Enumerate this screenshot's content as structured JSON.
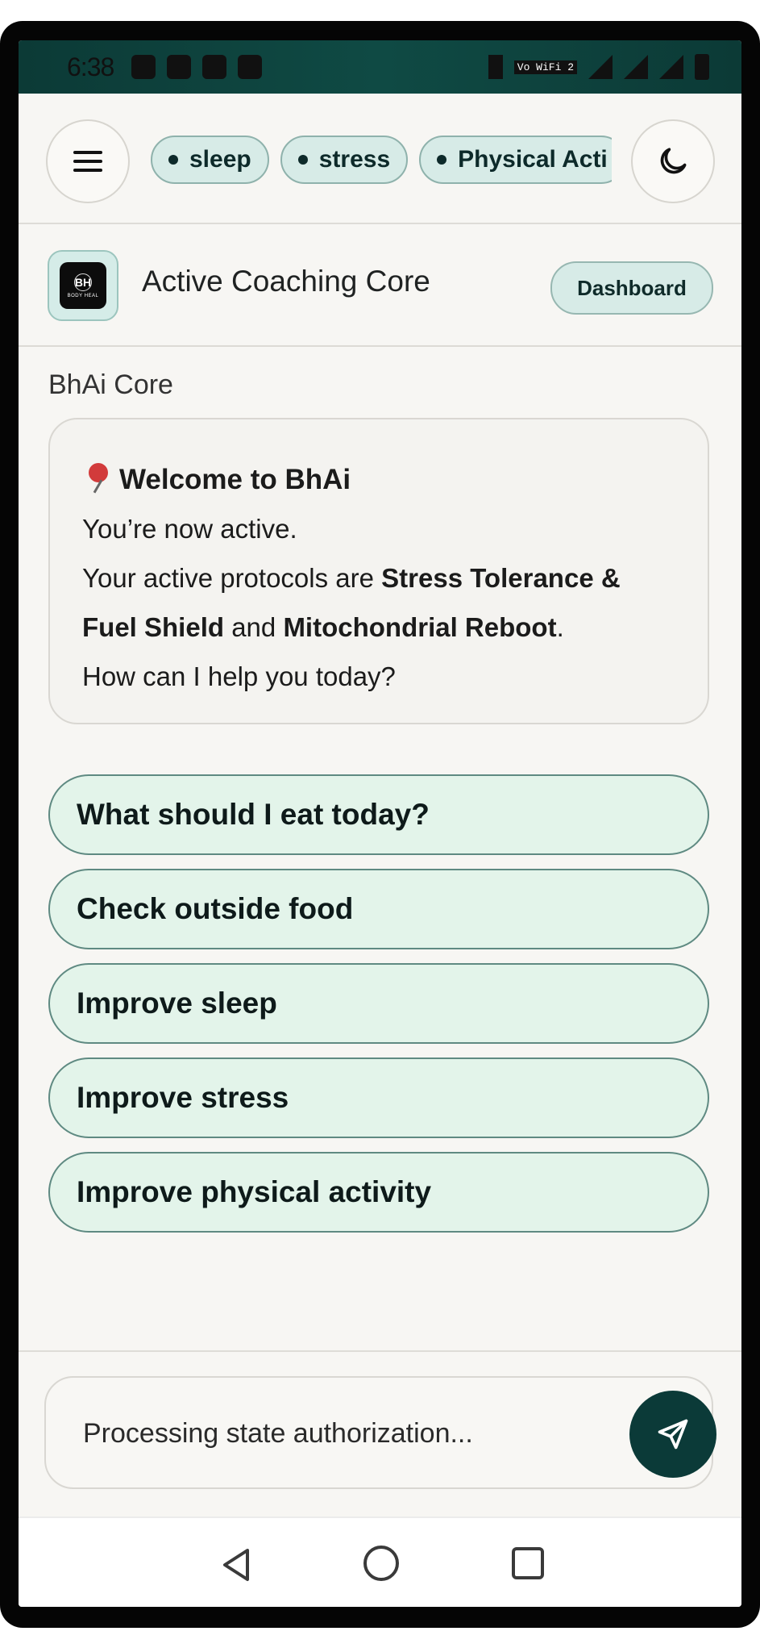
{
  "status_bar": {
    "time": "6:38",
    "network_label": "Vo WiFi 2"
  },
  "topbar": {
    "tags": [
      "sleep",
      "stress",
      "Physical Acti"
    ]
  },
  "header": {
    "logo_text": "BH",
    "logo_subtext": "BODY HEAL",
    "title": "Active Coaching Core",
    "dashboard_label": "Dashboard"
  },
  "chat": {
    "sender": "BhAi Core",
    "welcome_title": "Welcome to BhAi",
    "line1": "You’re now active.",
    "line2_prefix": "Your active protocols are ",
    "protocol1": "Stress Tolerance & Fuel Shield",
    "line2_and": " and ",
    "protocol2": "Mitochondrial Reboot",
    "line2_suffix": ".",
    "line3": "How can I help you today?"
  },
  "suggestions": [
    "What should I eat today?",
    "Check outside food",
    "Improve sleep",
    "Improve stress",
    "Improve physical activity"
  ],
  "input": {
    "placeholder": "Processing state authorization..."
  },
  "colors": {
    "accent": "#0b3a38",
    "chip_bg": "#d7ebe7",
    "suggestion_bg": "#e3f4ea"
  }
}
